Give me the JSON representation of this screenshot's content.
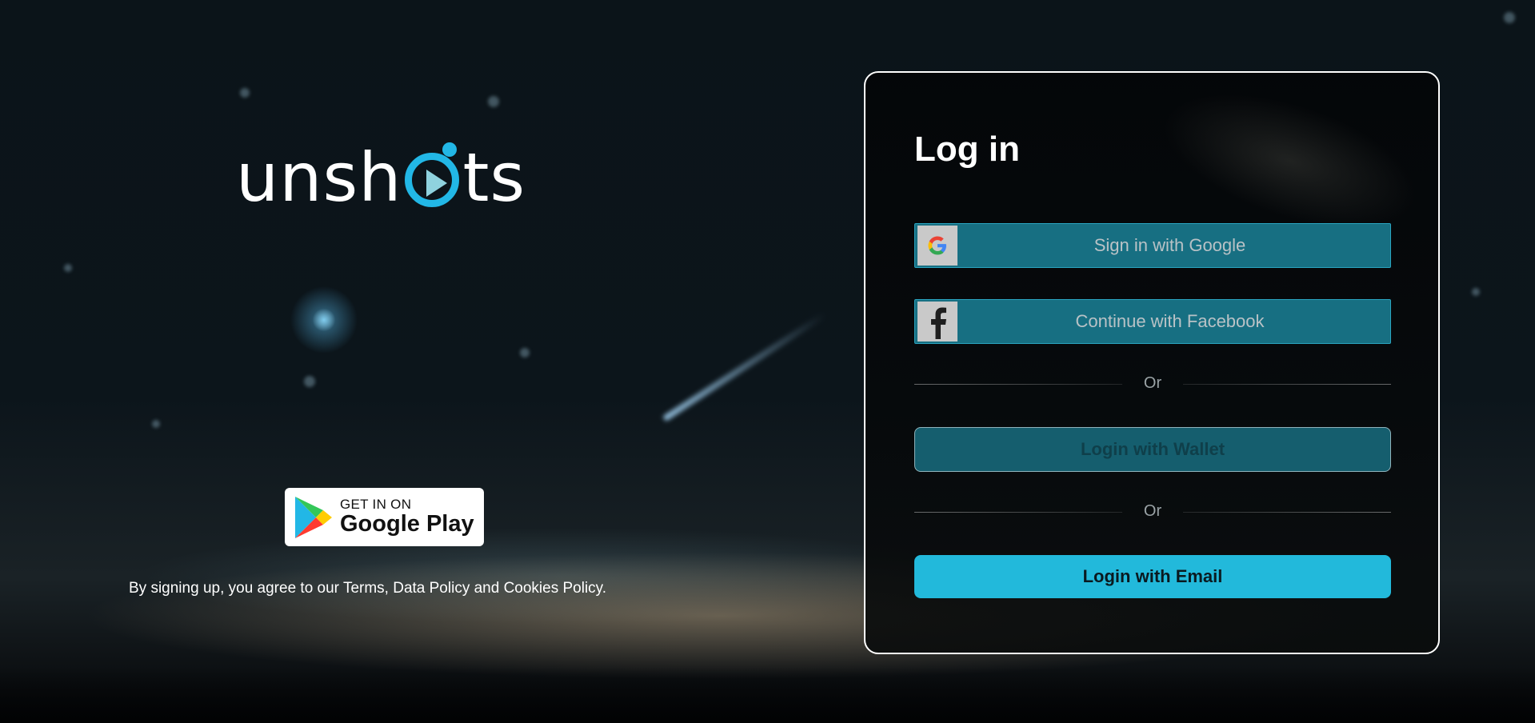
{
  "brand": {
    "logo_left": "unsh",
    "logo_right": "ts",
    "accent_color": "#22b7e6"
  },
  "store_badge": {
    "line1": "GET IN ON",
    "line2": "Google Play",
    "icon": "google-play-icon"
  },
  "legal": {
    "text": "By signing up, you agree to our Terms, Data Policy and Cookies Policy."
  },
  "login": {
    "title": "Log in",
    "google_label": "Sign in with Google",
    "google_icon": "google-g-icon",
    "facebook_label": "Continue with Facebook",
    "facebook_icon": "facebook-f-icon",
    "divider_1": "Or",
    "wallet_label": "Login with Wallet",
    "divider_2": "Or",
    "email_label": "Login with Email"
  },
  "colors": {
    "sso_bg": "#176f82",
    "wallet_bg": "#155e6e",
    "email_bg": "#22b9db"
  }
}
